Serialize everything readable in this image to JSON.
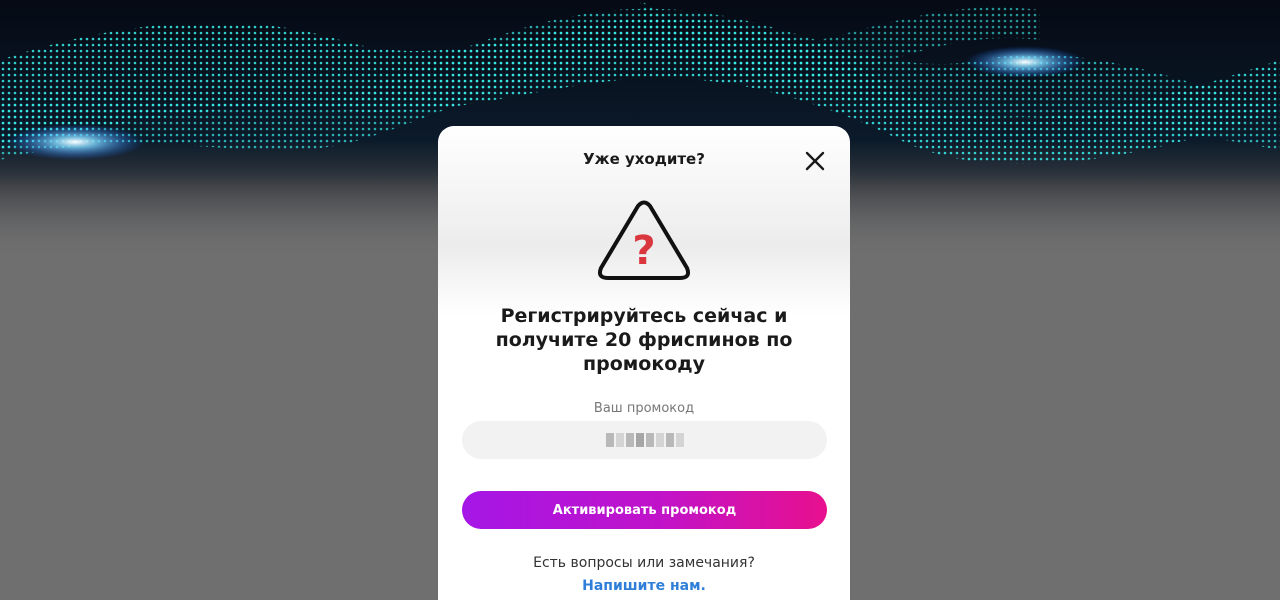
{
  "modal": {
    "title": "Уже уходите?",
    "headline": "Регистрируйтесь сейчас и получите 20 фриспинов по промокоду",
    "promo_label": "Ваш промокод",
    "activate_label": "Активировать промокод",
    "help_text": "Есть вопросы или замечания?",
    "help_link": "Напишите нам."
  },
  "colors": {
    "accent_start": "#a516e6",
    "accent_end": "#e8108e",
    "link": "#2f7fd8",
    "question_mark": "#d9363e",
    "wave": "#2ee6e0"
  },
  "icons": {
    "close": "close-icon",
    "warning": "warning-question-icon"
  }
}
